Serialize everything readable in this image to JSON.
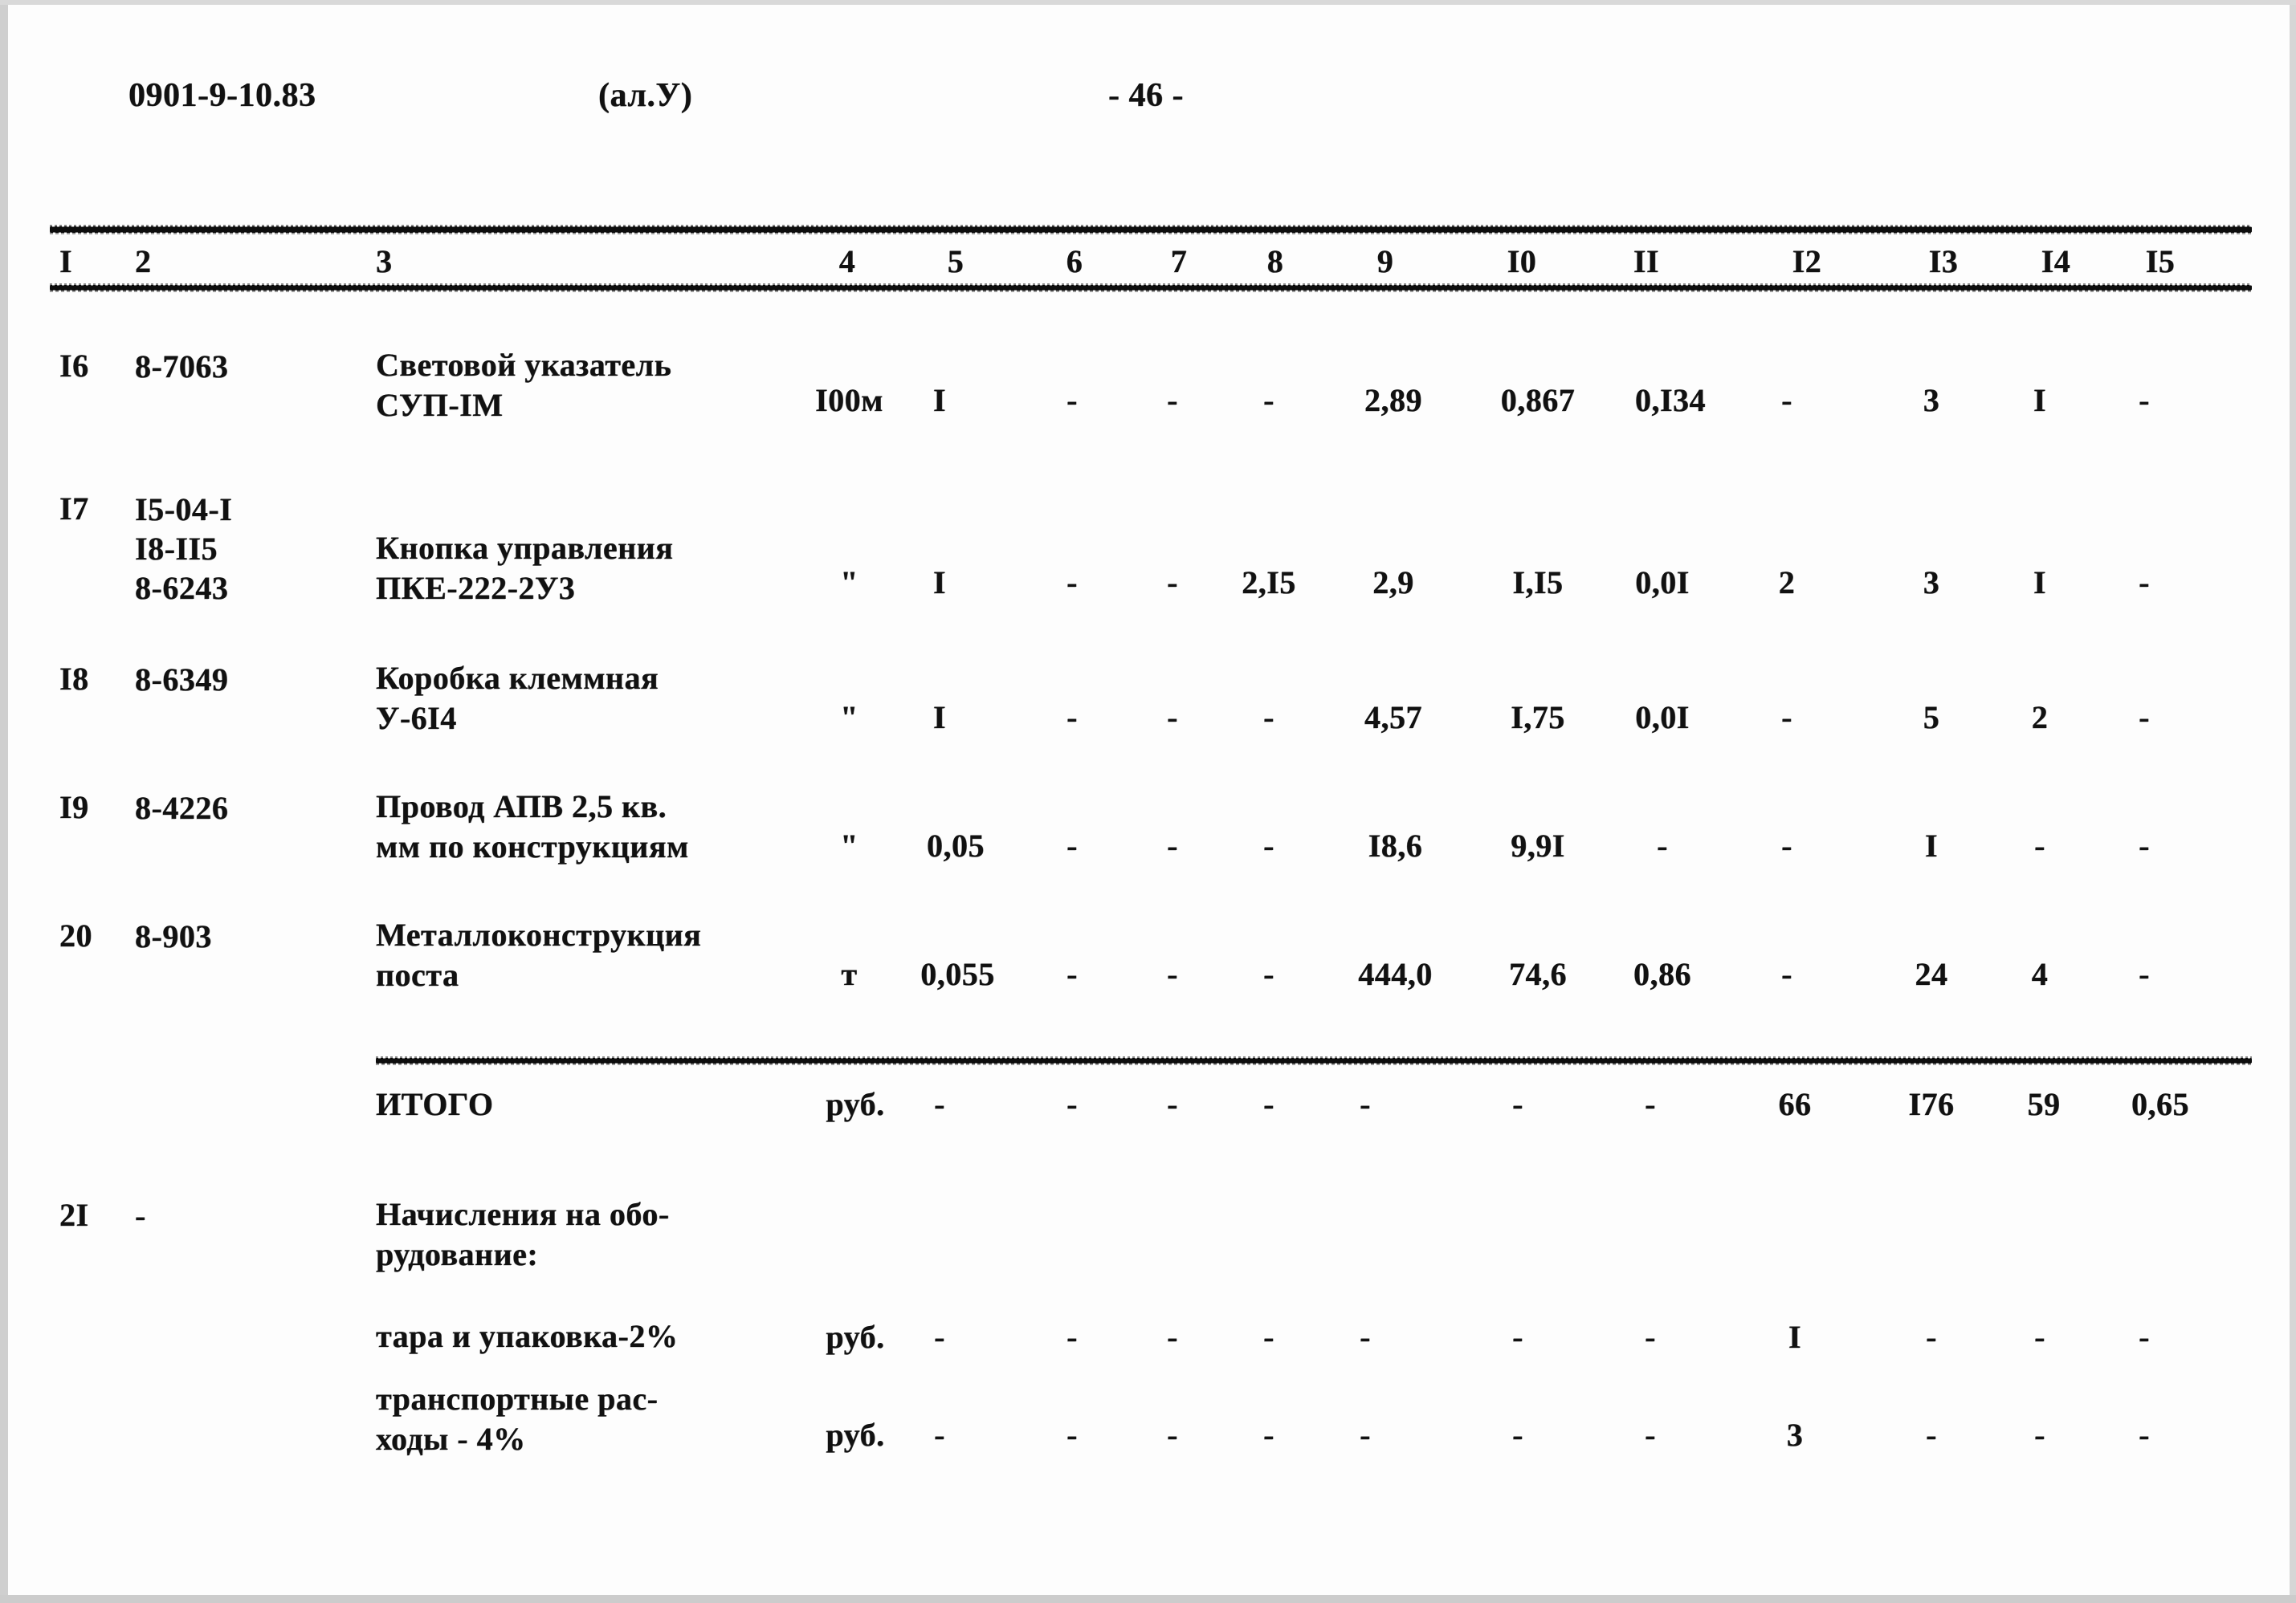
{
  "document": {
    "code": "0901-9-10.83",
    "album": "(ал.У)",
    "page_marker": "- 46 -"
  },
  "table": {
    "column_headers": [
      "I",
      "2",
      "3",
      "4",
      "5",
      "6",
      "7",
      "8",
      "9",
      "I0",
      "II",
      "I2",
      "I3",
      "I4",
      "I5"
    ],
    "rows": [
      {
        "num": "I6",
        "codes": [
          "8-7063"
        ],
        "description": [
          "Световой указатель",
          "СУП-IМ"
        ],
        "values": [
          "I00м",
          "I",
          "-",
          "-",
          "-",
          "2,89",
          "0,867",
          "0,I34",
          "-",
          "3",
          "I",
          "-"
        ]
      },
      {
        "num": "I7",
        "codes": [
          "I5-04-I",
          "I8-II5",
          "8-6243"
        ],
        "description": [
          "Кнопка управления",
          "ПКЕ-222-2У3"
        ],
        "values": [
          "\"",
          "I",
          "-",
          "-",
          "2,I5",
          "2,9",
          "I,I5",
          "0,0I",
          "2",
          "3",
          "I",
          "-"
        ]
      },
      {
        "num": "I8",
        "codes": [
          "8-6349"
        ],
        "description": [
          "Коробка клеммная",
          "У-6I4"
        ],
        "values": [
          "\"",
          "I",
          "-",
          "-",
          "-",
          "4,57",
          "I,75",
          "0,0I",
          "-",
          "5",
          "2",
          "-"
        ]
      },
      {
        "num": "I9",
        "codes": [
          "8-4226"
        ],
        "description": [
          "Провод АПВ 2,5 кв.",
          "мм по конструкциям"
        ],
        "values": [
          "\"",
          "0,05",
          "-",
          "-",
          "-",
          "I8,6",
          "9,9I",
          "-",
          "-",
          "I",
          "-",
          "-"
        ]
      },
      {
        "num": "20",
        "codes": [
          "8-903"
        ],
        "description": [
          "Металлоконструкция",
          "поста"
        ],
        "values": [
          "т",
          "0,055",
          "-",
          "-",
          "-",
          "444,0",
          "74,6",
          "0,86",
          "-",
          "24",
          "4",
          "-"
        ]
      }
    ],
    "total_row": {
      "label": "ИТОГО",
      "values": [
        "руб.",
        "-",
        "-",
        "-",
        "-",
        "-",
        "-",
        "-",
        "66",
        "I76",
        "59",
        "0,65"
      ]
    },
    "surcharge_block": {
      "num": "2I",
      "code": "-",
      "title": [
        "Начисления на обо-",
        "рудование:"
      ],
      "lines": [
        {
          "label": [
            "тара и упаковка-2%"
          ],
          "values": [
            "руб.",
            "-",
            "-",
            "-",
            "-",
            "-",
            "-",
            "-",
            "I",
            "-",
            "-",
            "-"
          ]
        },
        {
          "label": [
            "транспортные рас-",
            "ходы - 4%"
          ],
          "values": [
            "руб.",
            "-",
            "-",
            "-",
            "-",
            "-",
            "-",
            "-",
            "3",
            "-",
            "-",
            "-"
          ]
        }
      ]
    }
  }
}
